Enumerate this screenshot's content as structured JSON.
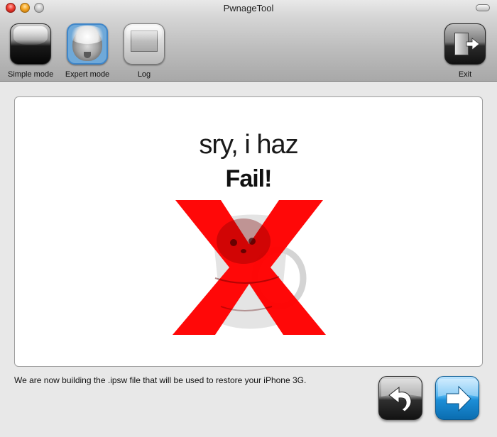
{
  "window": {
    "title": "PwnageTool"
  },
  "toolbar": {
    "simple_mode_label": "Simple mode",
    "expert_mode_label": "Expert mode",
    "log_label": "Log",
    "exit_label": "Exit"
  },
  "content": {
    "headline": "sry, i haz",
    "fail_text": "Fail!",
    "status_message": "We are now building the .ipsw file that will be used to restore your iPhone 3G."
  },
  "icons": {
    "simple_mode": "glossy-black-tile-icon",
    "expert_mode": "einstein-photo-icon",
    "log": "log-window-icon",
    "exit": "exit-door-icon",
    "back": "curved-back-arrow-icon",
    "next": "right-arrow-icon",
    "fail": "red-x-kitten-in-mug-icon"
  },
  "colors": {
    "fail_x": "#ff0000",
    "next_button": "#1c8ed7",
    "selected_tool_border": "#3f86c9"
  }
}
